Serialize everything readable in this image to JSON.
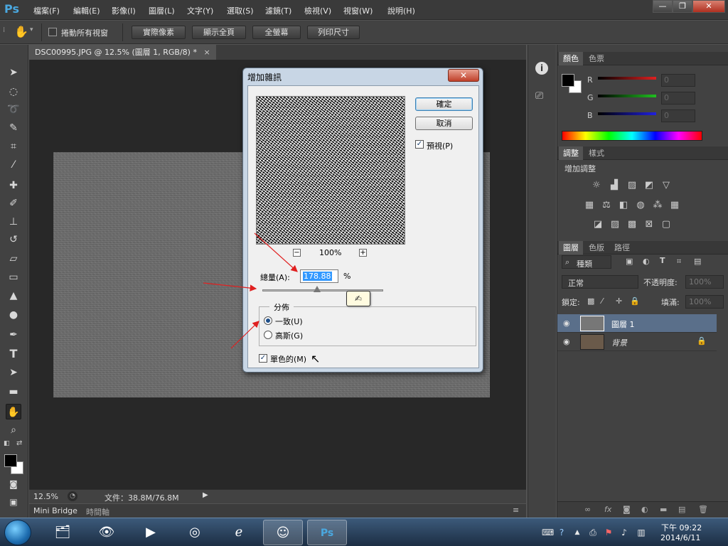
{
  "app": {
    "logo": "Ps",
    "menu": [
      "檔案(F)",
      "編輯(E)",
      "影像(I)",
      "圖層(L)",
      "文字(Y)",
      "選取(S)",
      "濾鏡(T)",
      "檢視(V)",
      "視窗(W)",
      "說明(H)"
    ]
  },
  "window_controls": {
    "minimize": "—",
    "restore": "❐",
    "close": "✕"
  },
  "options_bar": {
    "scroll_all_label": "捲動所有視窗",
    "scroll_all_checked": false,
    "buttons": [
      "實際像素",
      "顯示全頁",
      "全螢幕",
      "列印尺寸"
    ]
  },
  "document": {
    "tab_title": "DSC00995.JPG @ 12.5% (圖層 1, RGB/8) *",
    "tab_close": "×",
    "zoom": "12.5%",
    "doc_info": "文件：38.8M/76.8M"
  },
  "bottom_tabs": [
    "Mini Bridge",
    "時間軸"
  ],
  "dialog": {
    "title": "增加雜訊",
    "close_glyph": "✕",
    "ok_label": "確定",
    "cancel_label": "取消",
    "preview_label": "預視(P)",
    "preview_checked": true,
    "zoom_out": "−",
    "zoom_in": "+",
    "zoom_level": "100%",
    "amount_label": "總量(A):",
    "amount_value": "178.88",
    "amount_unit": "%",
    "amount_fraction": 0.45,
    "distribution_label": "分佈",
    "uniform_label": "一致(U)",
    "gaussian_label": "高斯(G)",
    "uniform_selected": true,
    "monochrome_label": "單色的(M)",
    "monochrome_checked": true
  },
  "color_panel": {
    "tabs": [
      "顏色",
      "色票"
    ],
    "channels": [
      {
        "label": "R",
        "value": "0",
        "color": "#e02020"
      },
      {
        "label": "G",
        "value": "0",
        "color": "#20c020"
      },
      {
        "label": "B",
        "value": "0",
        "color": "#2020e0"
      }
    ]
  },
  "adjustments_panel": {
    "tabs": [
      "調整",
      "樣式"
    ],
    "heading": "增加調整"
  },
  "layers_panel": {
    "tabs": [
      "圖層",
      "色版",
      "路徑"
    ],
    "filter_label": "種類",
    "blend_mode": "正常",
    "opacity_label": "不透明度:",
    "opacity_value": "100%",
    "lock_label": "鎖定:",
    "fill_label": "填滿:",
    "fill_value": "100%",
    "layers": [
      {
        "name": "圖層 1",
        "selected": true,
        "locked": false
      },
      {
        "name": "背景",
        "selected": false,
        "locked": true
      }
    ]
  },
  "taskbar": {
    "time": "下午 09:22",
    "date": "2014/6/11"
  },
  "colors": {
    "accent_ps": "#4aa8e0",
    "selection": "#3399ff",
    "layer_selected": "#5a6f8a"
  }
}
